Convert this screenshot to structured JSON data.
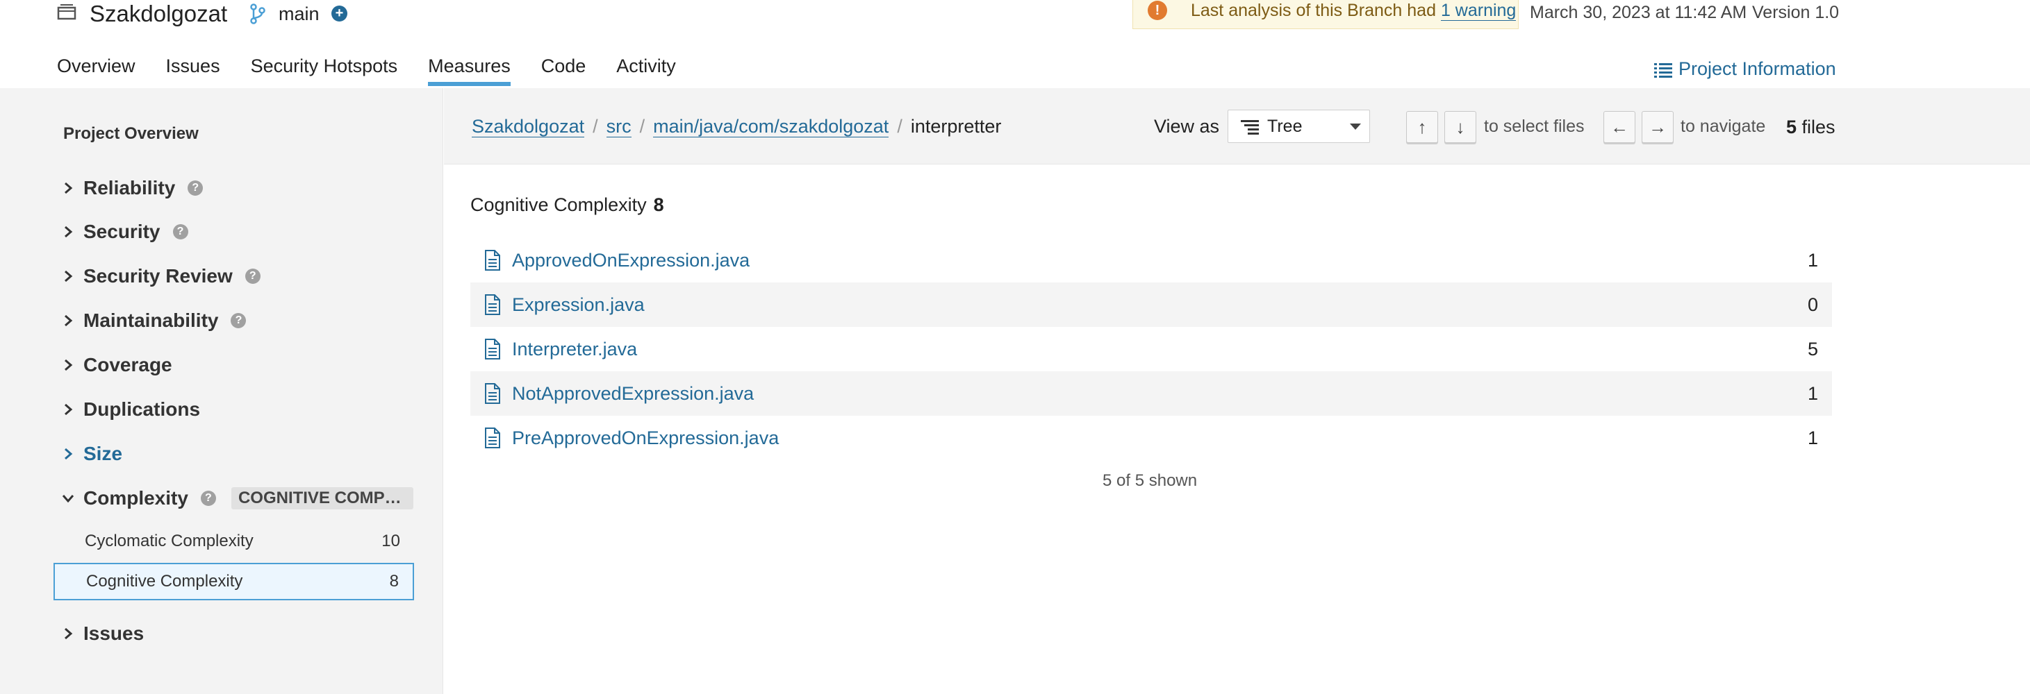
{
  "header": {
    "project_name": "Szakdolgozat",
    "branch": "main",
    "warning_prefix": "Last analysis of this Branch had ",
    "warning_link": "1 warning",
    "analysis_date": "March 30, 2023 at 11:42 AM",
    "version": "Version 1.0",
    "project_info": "Project Information"
  },
  "nav": {
    "tabs": [
      {
        "label": "Overview"
      },
      {
        "label": "Issues"
      },
      {
        "label": "Security Hotspots"
      },
      {
        "label": "Measures"
      },
      {
        "label": "Code"
      },
      {
        "label": "Activity"
      }
    ],
    "active": "Measures"
  },
  "sidebar": {
    "title": "Project Overview",
    "domains": [
      {
        "label": "Reliability"
      },
      {
        "label": "Security"
      },
      {
        "label": "Security Review"
      },
      {
        "label": "Maintainability"
      },
      {
        "label": "Coverage"
      },
      {
        "label": "Duplications"
      },
      {
        "label": "Size"
      },
      {
        "label": "Complexity",
        "badge": "COGNITIVE COMPLEXITY"
      },
      {
        "label": "Issues"
      }
    ],
    "metrics": [
      {
        "label": "Cyclomatic Complexity",
        "value": "10"
      },
      {
        "label": "Cognitive Complexity",
        "value": "8"
      }
    ]
  },
  "breadcrumb": {
    "items": [
      "Szakdolgozat",
      "src",
      "main/java/com/szakdolgozat"
    ],
    "current": "interpretter"
  },
  "toolbar": {
    "view_as_label": "View as",
    "view_as_value": "Tree",
    "up_key": "↑",
    "down_key": "↓",
    "select_hint": "to select files",
    "left_key": "←",
    "right_key": "→",
    "navigate_hint": "to navigate",
    "files_count": "5",
    "files_label": "files"
  },
  "measure": {
    "title": "Cognitive Complexity",
    "value": "8"
  },
  "files": [
    {
      "name": "ApprovedOnExpression.java",
      "value": "1"
    },
    {
      "name": "Expression.java",
      "value": "0"
    },
    {
      "name": "Interpreter.java",
      "value": "5"
    },
    {
      "name": "NotApprovedExpression.java",
      "value": "1"
    },
    {
      "name": "PreApprovedOnExpression.java",
      "value": "1"
    }
  ],
  "footer": {
    "shown": "5 of 5 shown"
  },
  "colors": {
    "link": "#236a97",
    "accent": "#4b9fd5",
    "warning": "#e17b30"
  }
}
